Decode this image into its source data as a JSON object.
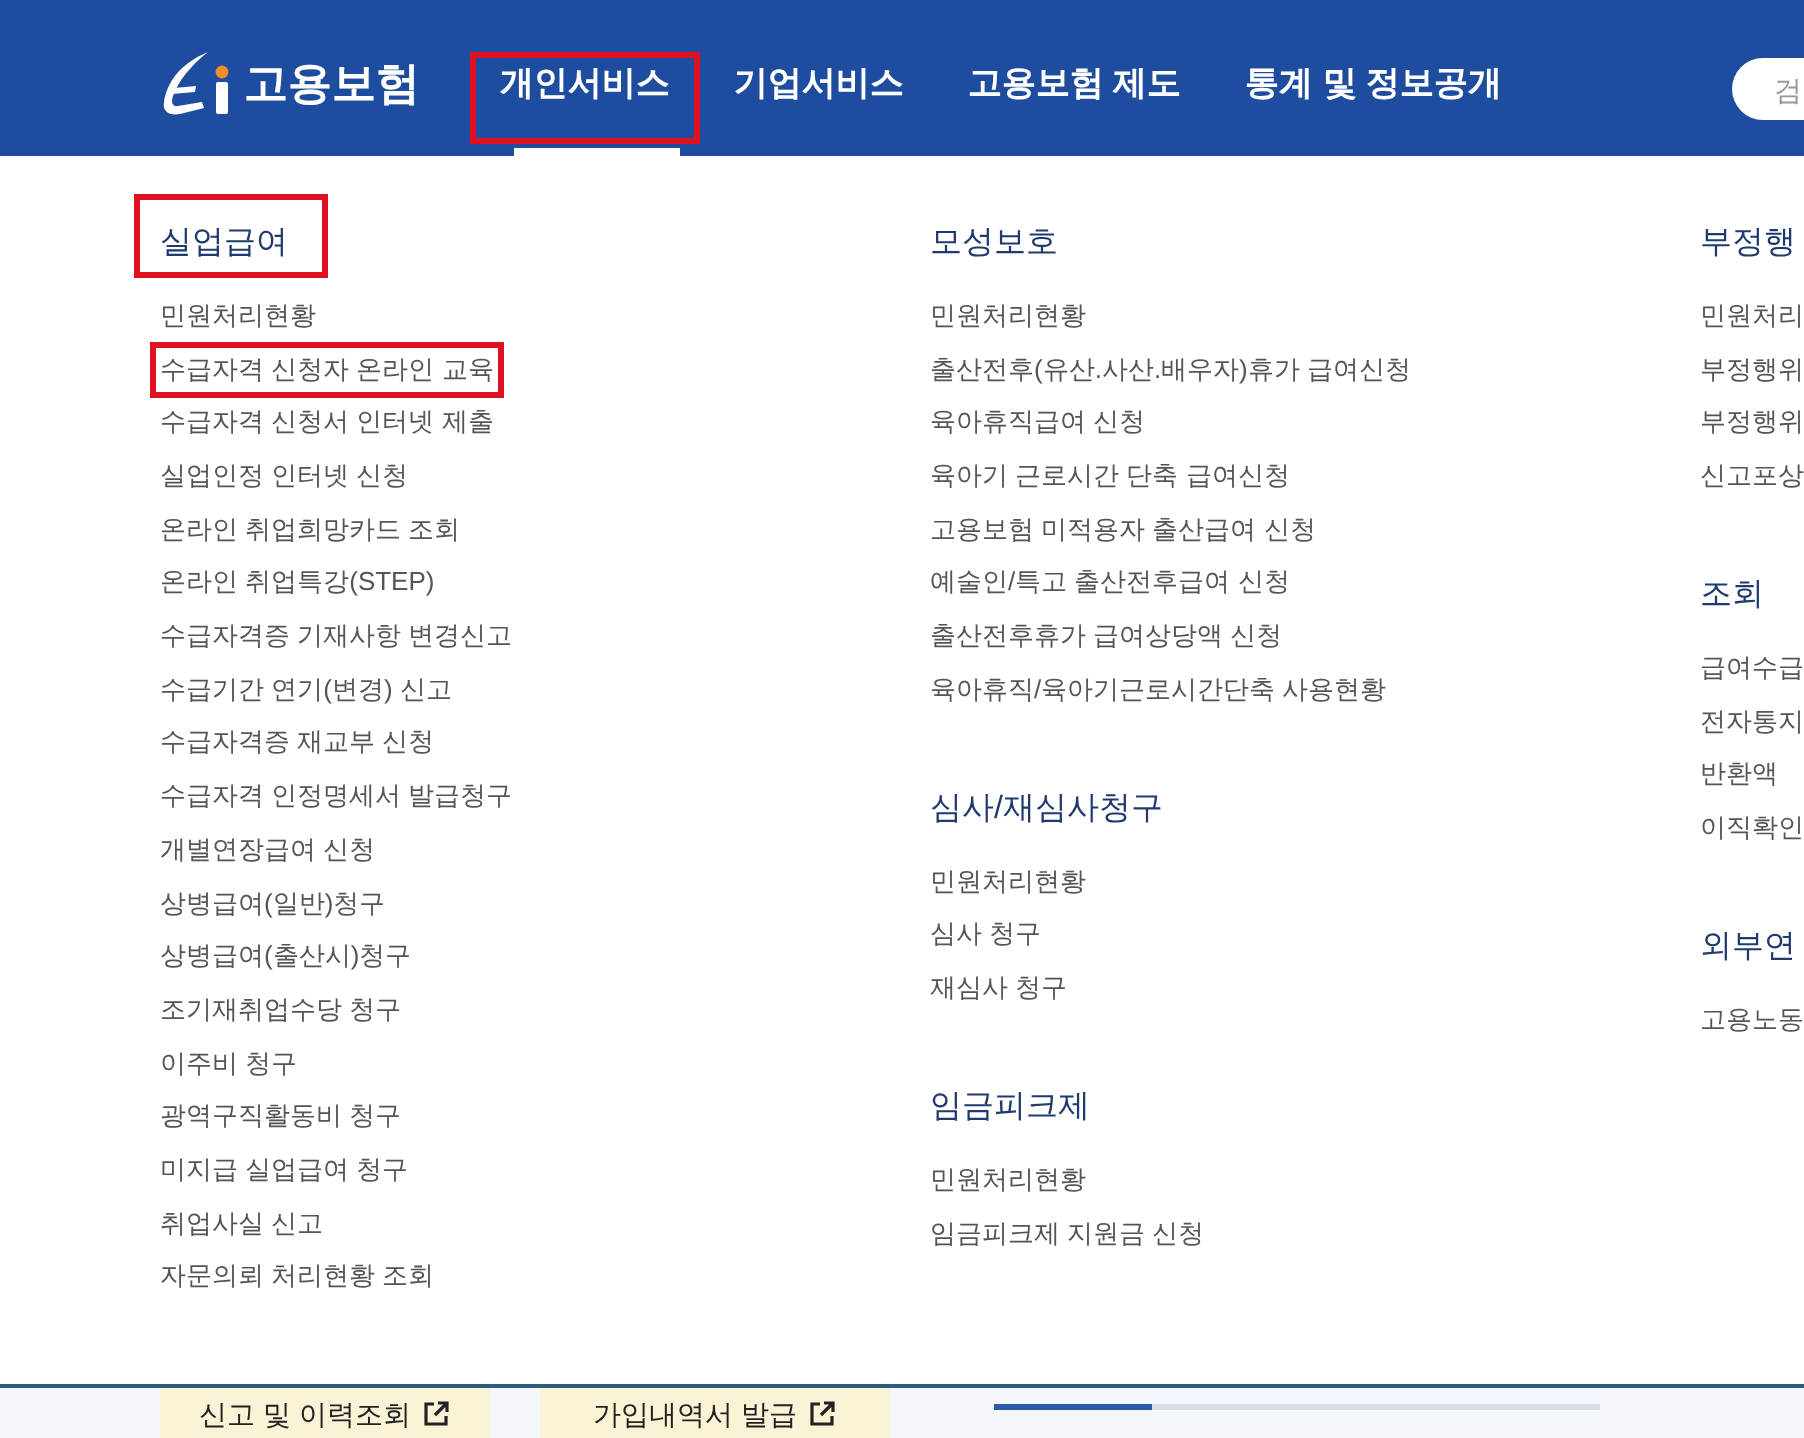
{
  "header": {
    "logo": {
      "text": "고용보험"
    },
    "nav": [
      {
        "label": "개인서비스",
        "selected": true,
        "highlighted": true
      },
      {
        "label": "기업서비스",
        "selected": false,
        "highlighted": false
      },
      {
        "label": "고용보험 제도",
        "selected": false,
        "highlighted": false
      },
      {
        "label": "통계 및 정보공개",
        "selected": false,
        "highlighted": false
      }
    ],
    "search": {
      "placeholder": "검"
    }
  },
  "menu": {
    "columns": [
      {
        "sections": [
          {
            "title": "실업급여",
            "highlighted": true,
            "items": [
              {
                "label": "민원처리현황",
                "highlighted": false
              },
              {
                "label": "수급자격 신청자 온라인 교육",
                "highlighted": true
              },
              {
                "label": "수급자격 신청서 인터넷 제출",
                "highlighted": false
              },
              {
                "label": "실업인정 인터넷 신청",
                "highlighted": false
              },
              {
                "label": "온라인 취업희망카드 조회",
                "highlighted": false
              },
              {
                "label": "온라인 취업특강(STEP)",
                "highlighted": false
              },
              {
                "label": "수급자격증 기재사항 변경신고",
                "highlighted": false
              },
              {
                "label": "수급기간 연기(변경) 신고",
                "highlighted": false
              },
              {
                "label": "수급자격증 재교부 신청",
                "highlighted": false
              },
              {
                "label": "수급자격 인정명세서 발급청구",
                "highlighted": false
              },
              {
                "label": "개별연장급여 신청",
                "highlighted": false
              },
              {
                "label": "상병급여(일반)청구",
                "highlighted": false
              },
              {
                "label": "상병급여(출산시)청구",
                "highlighted": false
              },
              {
                "label": "조기재취업수당 청구",
                "highlighted": false
              },
              {
                "label": "이주비 청구",
                "highlighted": false
              },
              {
                "label": "광역구직활동비 청구",
                "highlighted": false
              },
              {
                "label": "미지급 실업급여 청구",
                "highlighted": false
              },
              {
                "label": "취업사실 신고",
                "highlighted": false
              },
              {
                "label": "자문의뢰 처리현황 조회",
                "highlighted": false
              }
            ]
          }
        ]
      },
      {
        "sections": [
          {
            "title": "모성보호",
            "highlighted": false,
            "items": [
              {
                "label": "민원처리현황",
                "highlighted": false
              },
              {
                "label": "출산전후(유산.사산.배우자)휴가 급여신청",
                "highlighted": false
              },
              {
                "label": "육아휴직급여 신청",
                "highlighted": false
              },
              {
                "label": "육아기 근로시간 단축 급여신청",
                "highlighted": false
              },
              {
                "label": "고용보험 미적용자 출산급여 신청",
                "highlighted": false
              },
              {
                "label": "예술인/특고 출산전후급여 신청",
                "highlighted": false
              },
              {
                "label": "출산전후휴가 급여상당액 신청",
                "highlighted": false
              },
              {
                "label": "육아휴직/육아기근로시간단축 사용현황",
                "highlighted": false
              }
            ]
          },
          {
            "title": "심사/재심사청구",
            "highlighted": false,
            "items": [
              {
                "label": "민원처리현황",
                "highlighted": false
              },
              {
                "label": "심사 청구",
                "highlighted": false
              },
              {
                "label": "재심사 청구",
                "highlighted": false
              }
            ]
          },
          {
            "title": "임금피크제",
            "highlighted": false,
            "items": [
              {
                "label": "민원처리현황",
                "highlighted": false
              },
              {
                "label": "임금피크제 지원금 신청",
                "highlighted": false
              }
            ]
          }
        ]
      },
      {
        "sections": [
          {
            "title": "부정행",
            "highlighted": false,
            "items": [
              {
                "label": "민원처리",
                "highlighted": false
              },
              {
                "label": "부정행위",
                "highlighted": false
              },
              {
                "label": "부정행위",
                "highlighted": false
              },
              {
                "label": "신고포상",
                "highlighted": false
              }
            ]
          },
          {
            "title": "조회",
            "highlighted": false,
            "items": [
              {
                "label": "급여수급",
                "highlighted": false
              },
              {
                "label": "전자통지",
                "highlighted": false
              },
              {
                "label": "반환액",
                "highlighted": false
              },
              {
                "label": "이직확인",
                "highlighted": false
              }
            ]
          },
          {
            "title": "외부연",
            "highlighted": false,
            "items": [
              {
                "label": "고용노동",
                "highlighted": false
              }
            ]
          }
        ]
      }
    ]
  },
  "bottom_bar": {
    "buttons": [
      {
        "label": "신고 및 이력조회"
      },
      {
        "label": "가입내역서 발급"
      }
    ],
    "carousel_progress": {
      "level": 0.26
    }
  }
}
